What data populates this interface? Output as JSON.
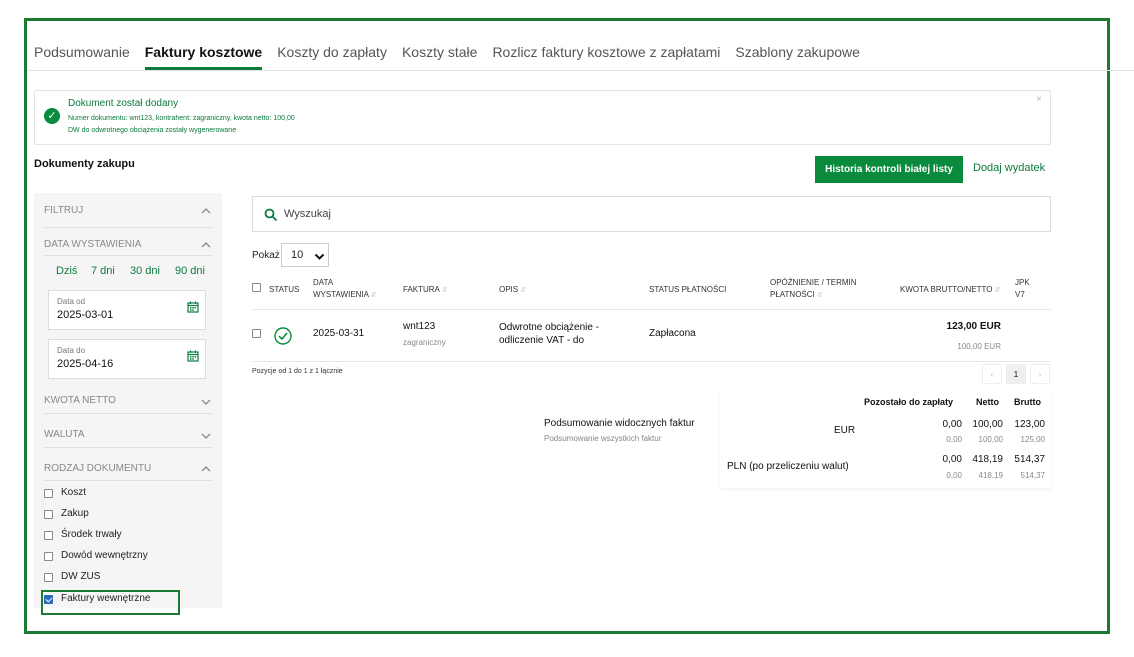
{
  "tabs": [
    "Podsumowanie",
    "Faktury kosztowe",
    "Koszty do zapłaty",
    "Koszty stałe",
    "Rozlicz faktury kosztowe z zapłatami",
    "Szablony zakupowe"
  ],
  "alert": {
    "title": "Dokument został dodany",
    "line1": "Numer dokumentu: wnt123, kontrahent: zagraniczny, kwota netto: 100,00",
    "line2": "DW do odwrotnego obciążenia zostały wygenerowane",
    "close": "×"
  },
  "page": {
    "title": "Dokumenty zakupu",
    "btn_history": "Historia kontroli białej listy",
    "btn_add": "Dodaj wydatek"
  },
  "filters": {
    "head": "FILTRUJ",
    "date_head": "DATA WYSTAWIENIA",
    "quick": [
      "Dziś",
      "7 dni",
      "30 dni",
      "90 dni"
    ],
    "date_from_label": "Data od",
    "date_from": "2025-03-01",
    "date_to_label": "Data do",
    "date_to": "2025-04-16",
    "net_head": "KWOTA NETTO",
    "currency_head": "WALUTA",
    "doctype_head": "RODZAJ DOKUMENTU",
    "doctypes": [
      {
        "label": "Koszt",
        "checked": false
      },
      {
        "label": "Zakup",
        "checked": false
      },
      {
        "label": "Środek trwały",
        "checked": false
      },
      {
        "label": "Dowód wewnętrzny",
        "checked": false
      },
      {
        "label": "DW ZUS",
        "checked": false
      },
      {
        "label": "Faktury wewnętrzne",
        "checked": true
      }
    ]
  },
  "search": {
    "placeholder": "Wyszukaj"
  },
  "pagesize": {
    "label": "Pokaż",
    "value": "10"
  },
  "table": {
    "headers": {
      "status": "STATUS",
      "date_l1": "DATA",
      "date_l2": "WYSTAWIENIA",
      "invoice": "FAKTURA",
      "desc": "OPIS",
      "paystatus": "STATUS PŁATNOŚCI",
      "delay_l1": "OPÓŹNIENIE / TERMIN",
      "delay_l2": "PŁATNOŚCI",
      "amount": "KWOTA BRUTTO/NETTO",
      "jpk_l1": "JPK",
      "jpk_l2": "V7"
    },
    "rows": [
      {
        "date": "2025-03-31",
        "invoice": "wnt123",
        "contractor": "zagraniczny",
        "desc_l1": "Odwrotne obciążenie -",
        "desc_l2": "odliczenie VAT - do",
        "paystatus": "Zapłacona",
        "gross": "123,00 EUR",
        "net": "100,00 EUR"
      }
    ],
    "footer": "Pozycje od 1 do 1 z 1 łącznie"
  },
  "pager": {
    "prev": "‹",
    "current": "1",
    "next": "›"
  },
  "summary": {
    "visible_label": "Podsumowanie widocznych faktur",
    "all_label": "Podsumowanie wszystkich faktur",
    "head_remaining": "Pozostało do zapłaty",
    "head_net": "Netto",
    "head_gross": "Brutto",
    "rows": [
      {
        "label": "EUR",
        "remaining": "0,00",
        "net": "100,00",
        "gross": "123,00",
        "remaining_all": "0,00",
        "net_all": "100,00",
        "gross_all": "125,00"
      },
      {
        "label": "PLN (po przeliczeniu walut)",
        "remaining": "0,00",
        "net": "418,19",
        "gross": "514,37",
        "remaining_all": "0,00",
        "net_all": "418,19",
        "gross_all": "514,37"
      }
    ]
  },
  "colors": {
    "accent": "#0a8a3d",
    "frame": "#1c7a32",
    "checkbox": "#2b66c0"
  }
}
